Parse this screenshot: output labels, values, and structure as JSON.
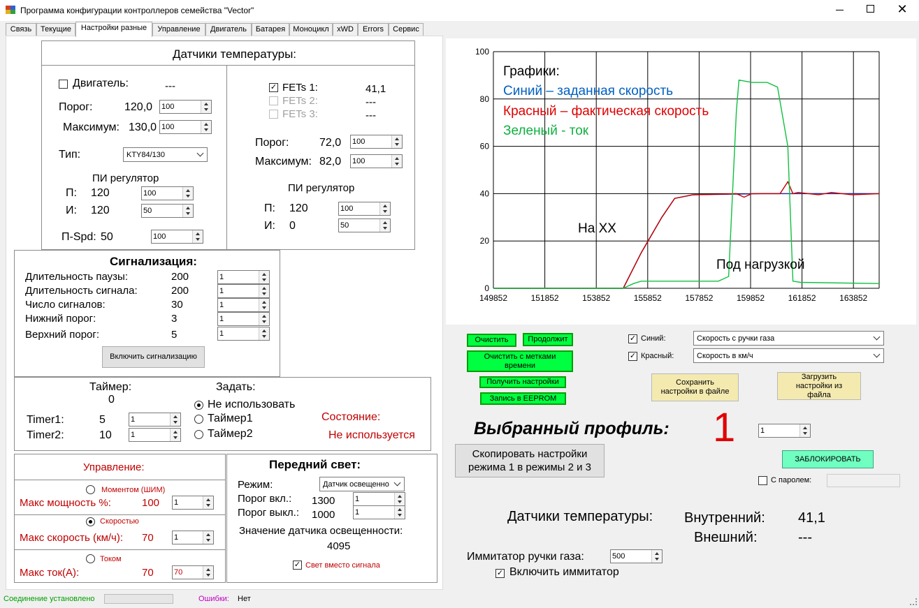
{
  "window": {
    "title": "Программа конфигурации контроллеров семейства \"Vector\""
  },
  "tabs": [
    "Связь",
    "Текущие",
    "Настройки разные",
    "Управление",
    "Двигатель",
    "Батарея",
    "Моноцикл",
    "xWD",
    "Errors",
    "Сервис"
  ],
  "temp": {
    "title": "Датчики температуры:",
    "motor_label": "Двигатель:",
    "motor_value": "---",
    "threshold_label": "Порог:",
    "motor_threshold": "120,0",
    "motor_threshold_input": "100",
    "max_label": "Максимум:",
    "motor_max": "130,0",
    "motor_max_input": "100",
    "type_label": "Тип:",
    "type_value": "KTY84/130",
    "pi_label": "ПИ регулятор",
    "p_label": "П:",
    "i_label": "И:",
    "motor_p": "120",
    "motor_p_input": "100",
    "motor_i": "120",
    "motor_i_input": "50",
    "pspd_label": "П-Spd:",
    "pspd": "50",
    "pspd_input": "100",
    "fets1_label": "FETs 1:",
    "fets1_value": "41,1",
    "fets2_label": "FETs 2:",
    "fets2_value": "---",
    "fets3_label": "FETs 3:",
    "fets3_value": "---",
    "fets_threshold": "72,0",
    "fets_threshold_input": "100",
    "fets_max": "82,0",
    "fets_max_input": "100",
    "fets_p": "120",
    "fets_p_input": "100",
    "fets_i": "0",
    "fets_i_input": "50"
  },
  "alarm": {
    "title": "Сигнализация:",
    "rows": [
      {
        "label": "Длительность паузы:",
        "value": "200",
        "input": "1"
      },
      {
        "label": "Длительность сигнала:",
        "value": "200",
        "input": "1"
      },
      {
        "label": "Число сигналов:",
        "value": "30",
        "input": "1"
      },
      {
        "label": "Нижний порог:",
        "value": "3",
        "input": "1"
      },
      {
        "label": "Верхний порог:",
        "value": "5",
        "input": "1"
      }
    ],
    "button": "Включить сигнализацию"
  },
  "timer": {
    "title": "Таймер:",
    "count": "0",
    "set_label": "Задать:",
    "options": [
      "Не использовать",
      "Таймер1",
      "Таймер2"
    ],
    "timer1_label": "Timer1:",
    "timer1_value": "5",
    "timer1_input": "1",
    "timer2_label": "Timer2:",
    "timer2_value": "10",
    "timer2_input": "1",
    "state_label": "Состояние:",
    "state_value": "Не используется"
  },
  "control": {
    "title": "Управление:",
    "modes": [
      {
        "radio": "Моментом (ШИМ)",
        "label": "Макс мощность %:",
        "value": "100",
        "input": "1"
      },
      {
        "radio": "Скоростью",
        "label": "Макс скорость (км/ч):",
        "value": "70",
        "input": "1"
      },
      {
        "radio": "Током",
        "label": "Макс ток(А):",
        "value": "70",
        "input": "70"
      }
    ]
  },
  "light": {
    "title": "Передний свет:",
    "mode_label": "Режим:",
    "mode_value": "Датчик освещенно",
    "on_label": "Порог вкл.:",
    "on_value": "1300",
    "on_input": "1",
    "off_label": "Порог выкл.:",
    "off_value": "1000",
    "off_input": "1",
    "sensor_label": "Значение датчика освещенности:",
    "sensor_value": "4095",
    "check_label": "Свет вместо сигнала"
  },
  "chart_data": {
    "type": "line",
    "xticks": [
      "149852",
      "151852",
      "153852",
      "155852",
      "157852",
      "159852",
      "161852",
      "163852"
    ],
    "yticks": [
      "0",
      "20",
      "40",
      "60",
      "80",
      "100"
    ],
    "ylim": [
      0,
      100
    ],
    "xlim": [
      149852,
      164852
    ],
    "grid": true,
    "annotations": [
      "Графики:",
      "Синий – заданная скорость",
      "Красный – фактическая скорость",
      "Зеленый - ток",
      "На XX",
      "Под нагрузкой"
    ],
    "series": [
      {
        "name": "Синий",
        "color": "#2a2aa0",
        "x": [
          149852,
          154900,
          155600,
          156400,
          156900,
          157600,
          160300,
          160800,
          161600,
          164852
        ],
        "y": [
          0,
          0,
          15,
          30,
          38,
          39.5,
          40,
          40,
          40,
          40
        ]
      },
      {
        "name": "Красный",
        "color": "#c00000",
        "x": [
          149852,
          154900,
          155600,
          156400,
          156900,
          157600,
          159300,
          159600,
          159900,
          160300,
          161000,
          161300,
          161500,
          161700,
          162500,
          163000,
          163800,
          164852
        ],
        "y": [
          0,
          0,
          15,
          30,
          38,
          39.5,
          40,
          38.5,
          40,
          40,
          40,
          45,
          40,
          40.5,
          39.5,
          40.5,
          39.5,
          40
        ]
      },
      {
        "name": "Зеленый",
        "color": "#10c040",
        "x": [
          149852,
          154900,
          155300,
          155600,
          156200,
          157200,
          158600,
          159000,
          159300,
          159400,
          159900,
          160500,
          160900,
          161300,
          161500,
          161800,
          164852
        ],
        "y": [
          0,
          0,
          2,
          3,
          3,
          3,
          3,
          5,
          75,
          88,
          87,
          87,
          85,
          60,
          3,
          2.5,
          2
        ]
      }
    ]
  },
  "buttons": {
    "clear": "Очистить",
    "continue": "Продолжит",
    "clear_ts": "Очистить с метками времени",
    "get_settings": "Получить настройки",
    "eeprom": "Запись в EEPROM",
    "save_file": "Сохранить настройки в файле",
    "load_file": "Загрузить настройки из файла",
    "copy": "Скопировать настройки режима 1 в режимы 2 и 3",
    "lock": "ЗАБЛОКИРОВАТЬ"
  },
  "series_select": {
    "blue_label": "Синий:",
    "blue_value": "Скорость с ручки газа",
    "red_label": "Красный:",
    "red_value": "Скорость в км/ч"
  },
  "profile": {
    "label": "Выбранный профиль:",
    "value": "1",
    "input": "1"
  },
  "password": {
    "label": "С паролем:"
  },
  "temps": {
    "title": "Датчики температуры:",
    "internal_label": "Внутренний:",
    "internal_value": "41,1",
    "external_label": "Внешний:",
    "external_value": "---"
  },
  "throttle": {
    "label": "Иммитатор ручки газа:",
    "input": "500",
    "check_label": "Включить иммитатор"
  },
  "status": {
    "connection": "Соединение установлено",
    "errors_label": "Ошибки:",
    "errors_value": "Нет"
  },
  "colors": {
    "green_button": "#00ff40",
    "yellow_button": "#f4eab0",
    "lock_button": "#70ffc0",
    "accent_red": "#c00000",
    "profile_red": "#e00000"
  }
}
